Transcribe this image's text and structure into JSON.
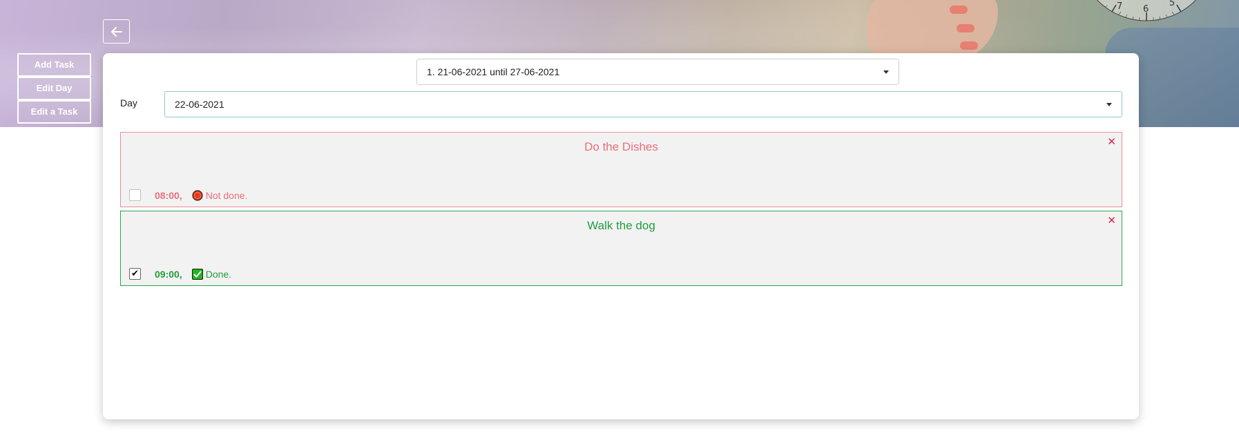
{
  "sidebar": {
    "items": [
      {
        "label": "Add Task"
      },
      {
        "label": "Edit Day"
      },
      {
        "label": "Edit a Task"
      }
    ]
  },
  "week_select": {
    "value": "1. 21-06-2021 until 27-06-2021"
  },
  "day": {
    "label": "Day",
    "value": "22-06-2021"
  },
  "tasks": [
    {
      "title": "Do the Dishes",
      "time": "08:00,",
      "status": "Not done.",
      "done": false,
      "accent": "#ea6f7c"
    },
    {
      "title": "Walk the dog",
      "time": "09:00,",
      "status": "Done.",
      "done": true,
      "accent": "#1f9e3e"
    }
  ],
  "clock_numerals": [
    "7",
    "6",
    "5"
  ],
  "colors": {
    "close": "#dc2340",
    "not_done_icon": "#e33a1a",
    "done_icon": "#22b61c"
  }
}
